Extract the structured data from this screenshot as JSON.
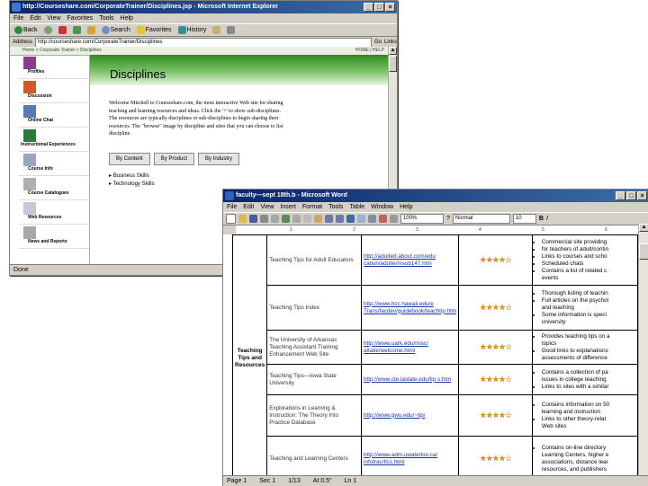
{
  "ie": {
    "title": "http://Courseshare.com/CorporateTrainer/Disciplines.jsp - Microsoft Internet Explorer",
    "menu": [
      "File",
      "Edit",
      "View",
      "Favorites",
      "Tools",
      "Help"
    ],
    "toolbar": [
      "Back",
      "Search",
      "Favorites",
      "History"
    ],
    "address": "http://courseshare.com/CorporateTrainer/Disciplines",
    "go": "Go",
    "links": "Links",
    "breadcrumb": "Home > Corporate Trainer > Disciplines",
    "breadcrumb_right": "HOME | HELP",
    "page_title": "Disciplines",
    "welcome": "Welcome Mitchell to Courseshare.com, the most interactive Web site for sharing teaching and learning resources and ideas. Click the '+' to show sub-disciplines. The resources are typically disciplines or sub-disciplines to begin sharing their resources. The \"browse\" image by discipline and sites that you can choose to list discipline.",
    "buttons": [
      "By Content",
      "By Product",
      "By Industry"
    ],
    "disciplines": [
      "Business Skills",
      "Technology Skills"
    ],
    "nav": [
      "Profiles",
      "Discussion",
      "Online Chat",
      "Instructional Experiences",
      "Course Info",
      "Course Catalogues",
      "Web Resources",
      "News and Reports"
    ],
    "status": "Done"
  },
  "word": {
    "title": "faculty—sept 18th.b - Microsoft Word",
    "menu": [
      "File",
      "Edit",
      "View",
      "Insert",
      "Format",
      "Tools",
      "Table",
      "Window",
      "Help"
    ],
    "zoom": "100%",
    "style": "Normal",
    "font_size": "10",
    "ruler": [
      "1",
      "2",
      "3",
      "4",
      "5",
      "6"
    ],
    "category": "Teaching Tips and Resources",
    "rows": [
      {
        "name": "Teaching Tips for Adult Educators",
        "url": "http://adulted.about.com/edu cation/adulte/msub147.htm",
        "stars": "★★★★☆",
        "notes": [
          "Commercial site providing",
          "for teachers of adult/contin",
          "Links to courses and scho",
          "Scheduled chats",
          "Contains a list of related c",
          "events"
        ]
      },
      {
        "name": "Teaching Tips Index",
        "url": "http://www.hcc.hawaii.edu/e Trans/facdev/guidebook/teachtip.htm",
        "stars": "★★★★☆",
        "notes": [
          "Thorough listing of teachin",
          "Full articles on the psychol",
          "and teaching",
          "Some information is speci",
          "university"
        ]
      },
      {
        "name": "The University of Arkansas Teaching Assistant Training Enhancement Web Site",
        "url": "http://www.uark.edu/misc/ altatie/welcome.html",
        "stars": "★★★★☆",
        "notes": [
          "Provides teaching tips on a",
          "topics",
          "Good links to explanations",
          "assessments of difference"
        ]
      },
      {
        "name": "Teaching Tips—Iowa State University",
        "url": "http://www.cte.iastate.edu/tip s.htm",
        "stars": "★★★★☆",
        "notes": [
          "Contains a collection of pa",
          "issues in college teaching",
          "Links to sites with a similar"
        ]
      },
      {
        "name": "Explorations in Learning & Instruction: The Theory Into Practice Database",
        "url": "http://www.gwu.edu/~tip/",
        "stars": "★★★★☆",
        "notes": [
          "Contains information on 50",
          "learning and instruction",
          "Links to other theory-relat",
          "Web sites"
        ]
      },
      {
        "name": "Teaching and Learning Centers",
        "url": "http://www.adm.uwaterloo.ca/ infotrac/tlcs.html",
        "stars": "★★★★☆",
        "notes": [
          "Contains on-line directory",
          "Learning Centers, higher e",
          "associations, distance lear",
          "resources, and publishers"
        ]
      }
    ],
    "status": [
      "Page 1",
      "Sec 1",
      "1/13",
      "At 0.5\"",
      "Ln 1"
    ]
  }
}
